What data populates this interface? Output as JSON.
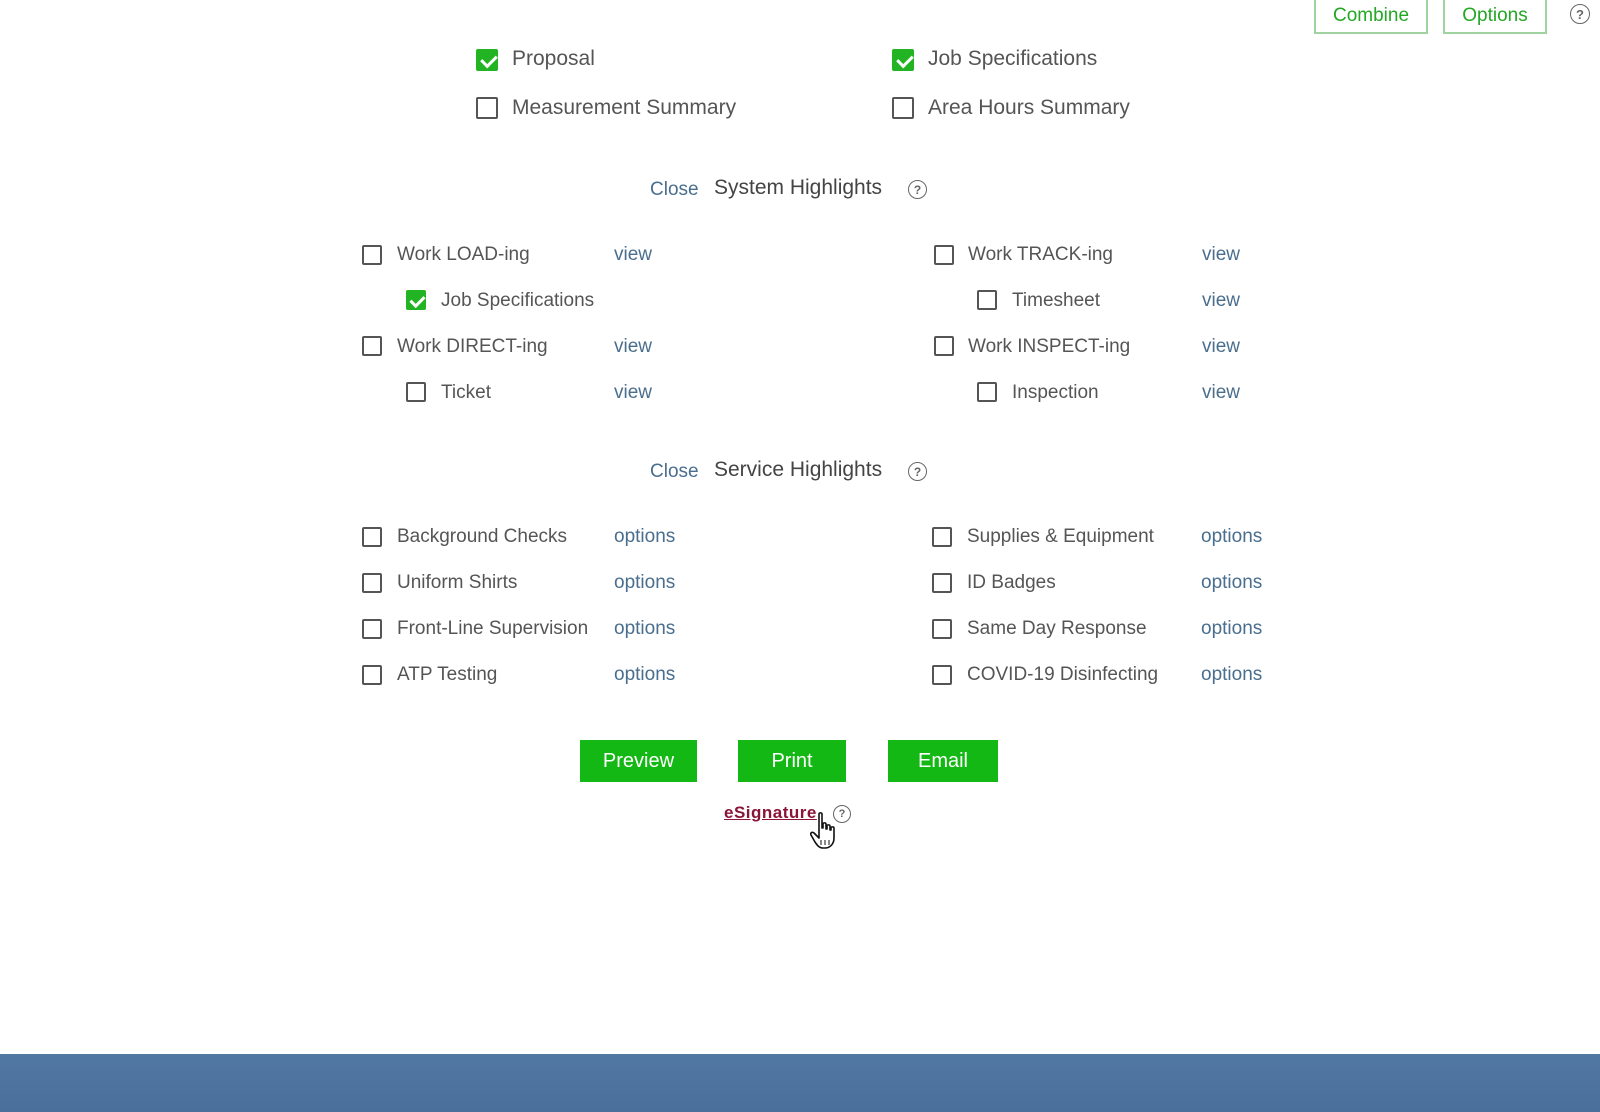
{
  "header": {
    "combine_label": "Combine",
    "options_label": "Options",
    "help_glyph": "?"
  },
  "documents": {
    "proposal": {
      "label": "Proposal",
      "checked": true
    },
    "job_specifications": {
      "label": "Job Specifications",
      "checked": true
    },
    "measurement_summary": {
      "label": "Measurement Summary",
      "checked": false
    },
    "area_hours_summary": {
      "label": "Area Hours Summary",
      "checked": false
    }
  },
  "system_highlights": {
    "close_label": "Close",
    "title": "System Highlights",
    "help_glyph": "?",
    "work_loading": {
      "label": "Work LOAD-ing",
      "link": "view",
      "checked": false
    },
    "job_specifications": {
      "label": "Job Specifications",
      "checked": true
    },
    "work_directing": {
      "label": "Work DIRECT-ing",
      "link": "view",
      "checked": false
    },
    "ticket": {
      "label": "Ticket",
      "link": "view",
      "checked": false
    },
    "work_tracking": {
      "label": "Work TRACK-ing",
      "link": "view",
      "checked": false
    },
    "timesheet": {
      "label": "Timesheet",
      "link": "view",
      "checked": false
    },
    "work_inspecting": {
      "label": "Work INSPECT-ing",
      "link": "view",
      "checked": false
    },
    "inspection": {
      "label": "Inspection",
      "link": "view",
      "checked": false
    }
  },
  "service_highlights": {
    "close_label": "Close",
    "title": "Service Highlights",
    "help_glyph": "?",
    "background_checks": {
      "label": "Background Checks",
      "link": "options",
      "checked": false
    },
    "uniform_shirts": {
      "label": "Uniform Shirts",
      "link": "options",
      "checked": false
    },
    "front_line_supervision": {
      "label": "Front-Line Supervision",
      "link": "options",
      "checked": false
    },
    "atp_testing": {
      "label": "ATP Testing",
      "link": "options",
      "checked": false
    },
    "supplies_equipment": {
      "label": "Supplies & Equipment",
      "link": "options",
      "checked": false
    },
    "id_badges": {
      "label": "ID Badges",
      "link": "options",
      "checked": false
    },
    "same_day_response": {
      "label": "Same Day Response",
      "link": "options",
      "checked": false
    },
    "covid_disinfecting": {
      "label": "COVID-19 Disinfecting",
      "link": "options",
      "checked": false
    }
  },
  "actions": {
    "preview_label": "Preview",
    "print_label": "Print",
    "email_label": "Email",
    "esignature_label": "eSignature",
    "help_glyph": "?"
  },
  "colors": {
    "accent_green": "#14b814",
    "link_blue": "#4a6e8e",
    "esignature": "#8a1538",
    "footer_bar": "#4a6f9a"
  }
}
